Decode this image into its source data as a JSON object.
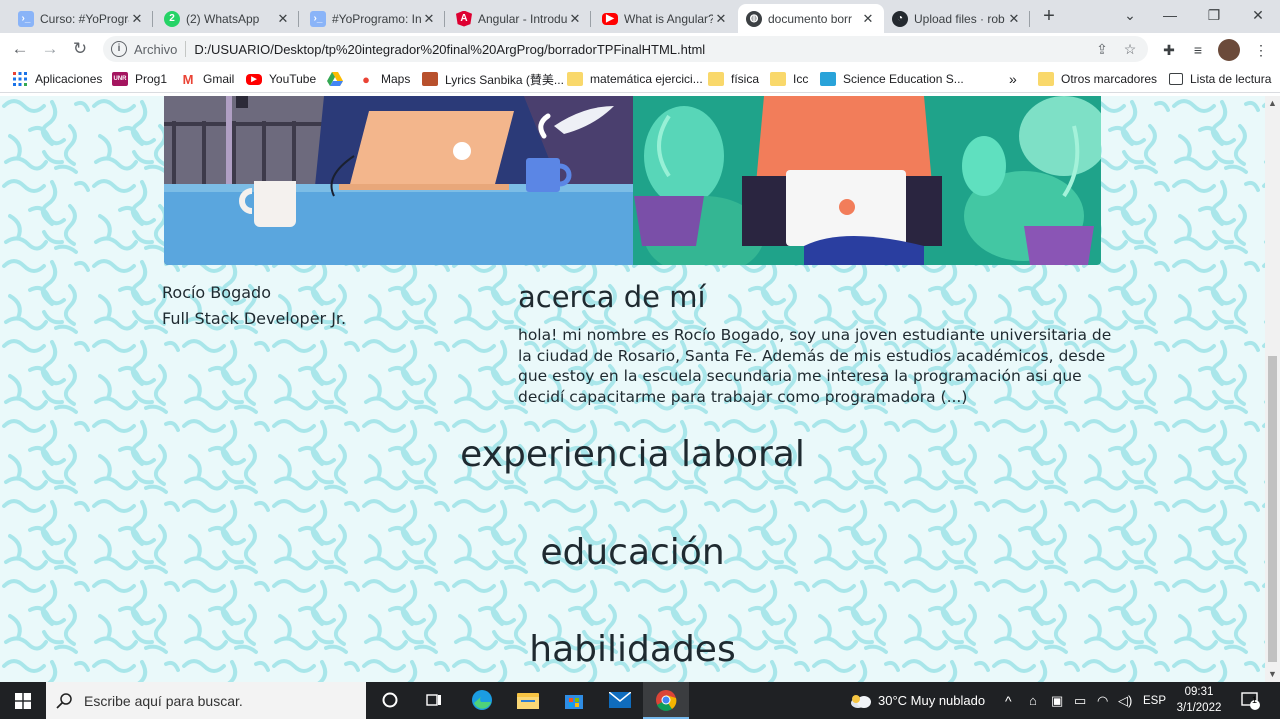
{
  "browser": {
    "tabs": [
      {
        "title": "Curso: #YoProgramo",
        "favicon": "terminal-icon"
      },
      {
        "title": "(2) WhatsApp",
        "favicon": "whatsapp-icon"
      },
      {
        "title": "#YoProgramo: Int",
        "favicon": "terminal-icon"
      },
      {
        "title": "Angular - Introdu",
        "favicon": "angular-icon"
      },
      {
        "title": "What is Angular?",
        "favicon": "youtube-icon"
      },
      {
        "title": "documento borr",
        "favicon": "globe-icon",
        "active": true
      },
      {
        "title": "Upload files · rob",
        "favicon": "github-icon"
      }
    ],
    "omnibox": {
      "security_chip": "Archivo",
      "url": "D:/USUARIO/Desktop/tp%20integrador%20final%20ArgProg/borradorTPFinalHTML.html"
    },
    "bookmarks": [
      {
        "label": "Aplicaciones",
        "icon": "apps-grid-icon"
      },
      {
        "label": "Prog1",
        "icon": "prog1-icon"
      },
      {
        "label": "Gmail",
        "icon": "gmail-icon"
      },
      {
        "label": "YouTube",
        "icon": "youtube-icon"
      },
      {
        "label": "",
        "icon": "drive-icon"
      },
      {
        "label": "Maps",
        "icon": "maps-icon"
      },
      {
        "label": "Lyrics Sanbika (賛美...",
        "icon": "lyrics-icon"
      },
      {
        "label": "matemática ejercici...",
        "icon": "folder-icon"
      },
      {
        "label": "física",
        "icon": "folder-icon"
      },
      {
        "label": "Icc",
        "icon": "folder-icon"
      },
      {
        "label": "Science Education S...",
        "icon": "science-icon"
      }
    ],
    "bookmarks_overflow": "»",
    "other_bookmarks": "Otros marcadores",
    "reading_list": "Lista de lectura"
  },
  "page": {
    "name": "Rocío Bogado",
    "role": "Full Stack Developer Jr.",
    "about_heading": "acerca de mí",
    "about_text": "hola! mi nombre es Rocío Bogado, soy una joven estudiante universitaria de la ciudad de Rosario, Santa Fe. Además de mis estudios académicos, desde que estoy en la escuela secundaria me interesa la programación asi que decidí capacitarme para trabajar como programadora (...)",
    "sections": [
      "experiencia laboral",
      "educación",
      "habilidades"
    ]
  },
  "taskbar": {
    "search_placeholder": "Escribe aquí para buscar.",
    "weather": "30°C  Muy nublado",
    "language": "ESP",
    "time": "09:31",
    "date": "3/1/2022",
    "notification_count": "1"
  },
  "colors": {
    "tab_strip": "#dee1e6",
    "page_bg": "#eaf9fa",
    "squiggle": "#a9e6ea",
    "taskbar": "#1f2124"
  }
}
